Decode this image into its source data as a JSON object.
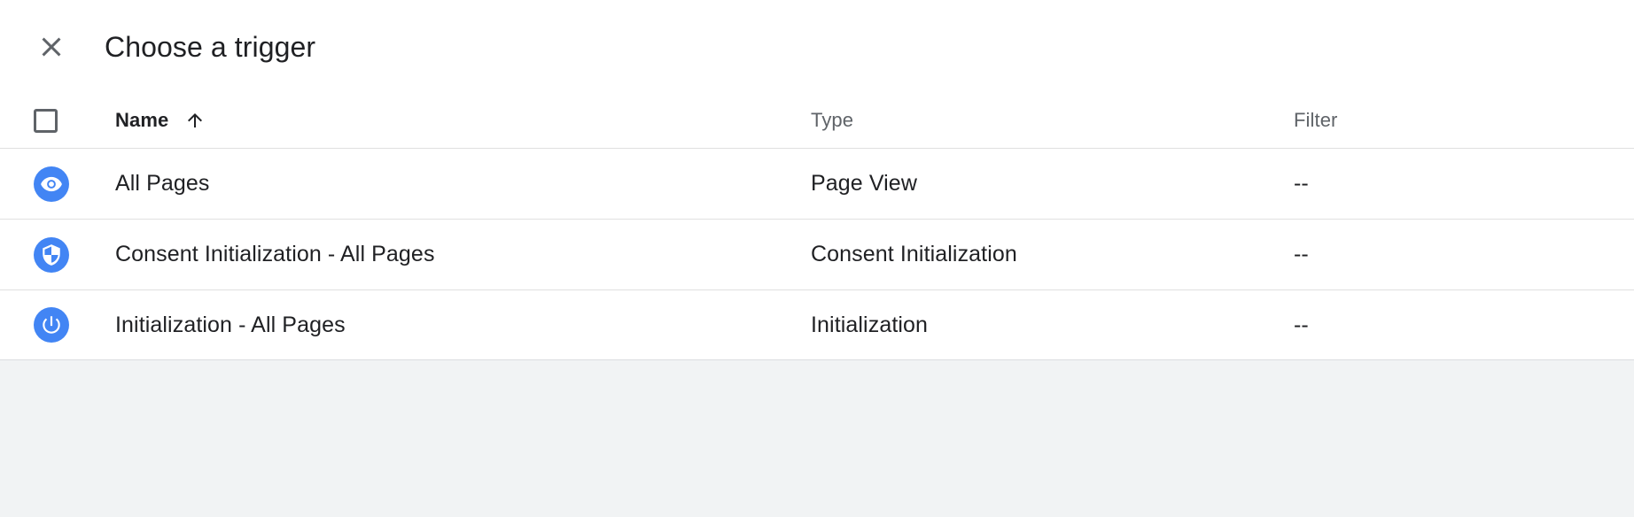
{
  "dialog": {
    "title": "Choose a trigger",
    "close_icon": "close-icon"
  },
  "table": {
    "select_all_checkbox": {
      "checked": false
    },
    "columns": {
      "name": "Name",
      "type": "Type",
      "filter": "Filter"
    },
    "sort": {
      "column": "Name",
      "direction": "ascending",
      "icon": "arrow-upward-icon"
    },
    "rows": [
      {
        "icon": "eye-icon",
        "name": "All Pages",
        "type": "Page View",
        "filter": "--"
      },
      {
        "icon": "shield-icon",
        "name": "Consent Initialization - All Pages",
        "type": "Consent Initialization",
        "filter": "--"
      },
      {
        "icon": "power-icon",
        "name": "Initialization - All Pages",
        "type": "Initialization",
        "filter": "--"
      }
    ]
  },
  "colors": {
    "icon_badge": "#4285f4",
    "surface": "#ffffff",
    "backdrop": "#f1f3f4",
    "text_primary": "#202124",
    "text_secondary": "#5f6368",
    "divider": "#e0e0e0"
  }
}
